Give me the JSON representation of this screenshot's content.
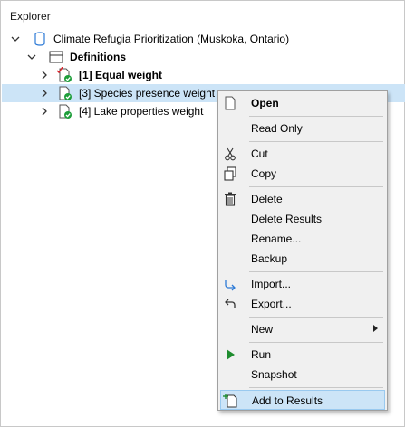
{
  "panel": {
    "title": "Explorer"
  },
  "tree": {
    "root": "Climate Refugia Prioritization (Muskoka, Ontario)",
    "definitions": "Definitions",
    "items": [
      {
        "label": "[1] Equal weight"
      },
      {
        "label": "[3] Species presence weight"
      },
      {
        "label": "[4] Lake properties weight"
      }
    ]
  },
  "menu": {
    "open": "Open",
    "read_only": "Read Only",
    "cut": "Cut",
    "copy": "Copy",
    "delete": "Delete",
    "delete_results": "Delete Results",
    "rename": "Rename...",
    "backup": "Backup",
    "import": "Import...",
    "export": "Export...",
    "new": "New",
    "run": "Run",
    "snapshot": "Snapshot",
    "add_to_results": "Add to Results"
  },
  "colors": {
    "selection": "#cce4f7",
    "check_green": "#1e9e3a",
    "run_green": "#1e8c2e",
    "accent_blue": "#2d7ad6",
    "red_check": "#d9232a"
  }
}
